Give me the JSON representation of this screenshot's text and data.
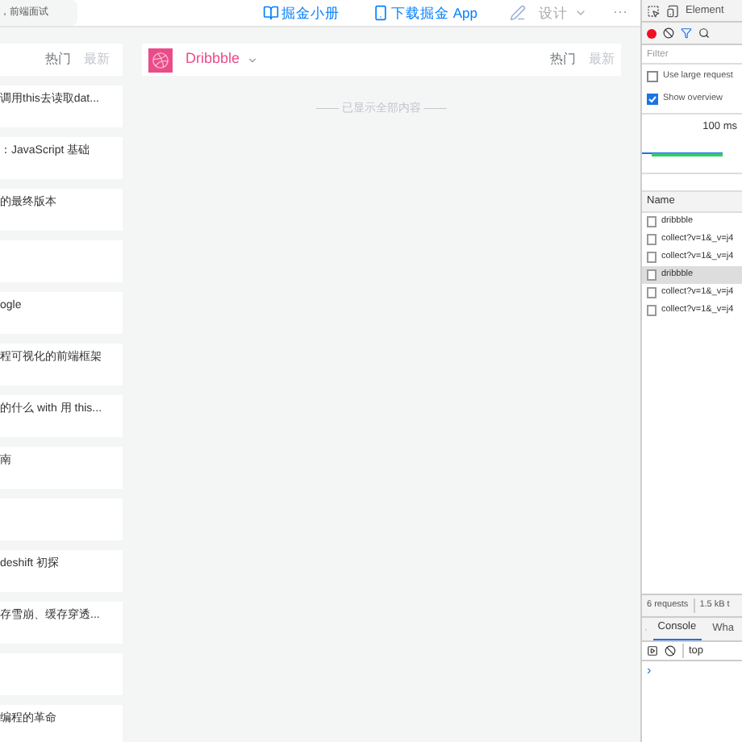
{
  "header": {
    "search": {
      "value": "，前端面试"
    },
    "links": [
      {
        "kind": "book",
        "label": "掘金小册"
      },
      {
        "kind": "phone",
        "label": "下载掘金 App"
      }
    ],
    "category": "设计",
    "more": "···"
  },
  "left_column": {
    "tabs": [
      {
        "label": "热门",
        "selected": true
      },
      {
        "label": "最新",
        "selected": false
      }
    ],
    "cards": [
      {
        "kind": "text",
        "title": "调用this去读取dat..."
      },
      {
        "kind": "text",
        "title": "：JavaScript 基础"
      },
      {
        "kind": "text",
        "title": "的最终版本"
      },
      {
        "kind": "blank"
      },
      {
        "kind": "text",
        "title": "ogle"
      },
      {
        "kind": "text",
        "title": "程可视化的前端框架"
      },
      {
        "kind": "text",
        "title": "的什么 with 用 this..."
      },
      {
        "kind": "text",
        "title": "南"
      },
      {
        "kind": "blank"
      },
      {
        "kind": "text",
        "title": "deshift 初探"
      },
      {
        "kind": "text",
        "title": "存雪崩、缓存穿透..."
      },
      {
        "kind": "blank"
      },
      {
        "kind": "text",
        "title": "编程的革命"
      }
    ]
  },
  "dribbble_column": {
    "name": "Dribbble",
    "tabs": [
      {
        "label": "热门",
        "selected": true
      },
      {
        "label": "最新",
        "selected": false
      }
    ],
    "end_note": "—— 已显示全部内容 ——"
  },
  "devtools": {
    "panel_tab": "Element",
    "filter": {
      "placeholder": "Filter"
    },
    "options": [
      {
        "label": "Use large request",
        "checked": false
      },
      {
        "label": "Show overview",
        "checked": true
      }
    ],
    "overview_label": "100 ms",
    "name_header": "Name",
    "requests": [
      {
        "name": "dribbble",
        "selected": false
      },
      {
        "name": "collect?v=1&_v=j4",
        "selected": false
      },
      {
        "name": "collect?v=1&_v=j4",
        "selected": false
      },
      {
        "name": "dribbble",
        "selected": true
      },
      {
        "name": "collect?v=1&_v=j4",
        "selected": false
      },
      {
        "name": "collect?v=1&_v=j4",
        "selected": false
      }
    ],
    "summary": [
      "6 requests",
      "1.5 kB t"
    ],
    "drawer_tabs": [
      {
        "label": "Console",
        "selected": true
      },
      {
        "label": "Wha",
        "selected": false
      }
    ],
    "context": "top",
    "prompt": "›"
  }
}
